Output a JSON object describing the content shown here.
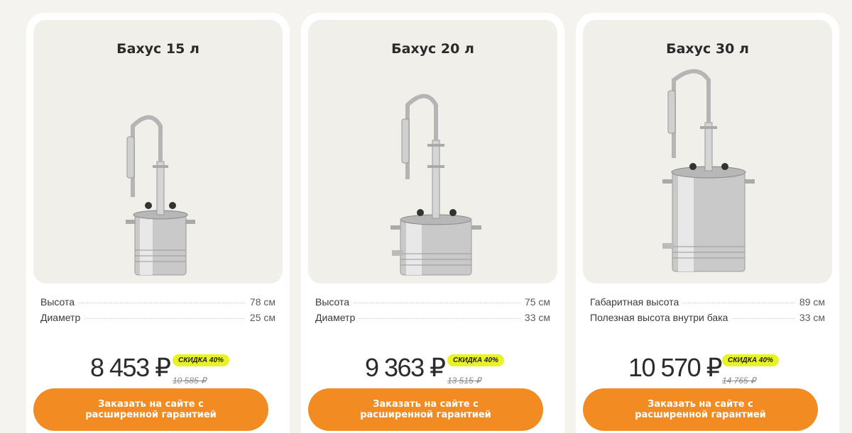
{
  "products": [
    {
      "title": "Бахус 15 л",
      "specs": [
        {
          "label": "Высота",
          "value": "78 см"
        },
        {
          "label": "Диаметр",
          "value": "25 см"
        }
      ],
      "price": "8 453 ₽",
      "discount": "СКИДКА 40%",
      "old_price": "10 585 ₽",
      "cta": "Заказать на сайте с расширенной гарантией"
    },
    {
      "title": "Бахус 20 л",
      "specs": [
        {
          "label": "Высота",
          "value": "75 см"
        },
        {
          "label": "Диаметр",
          "value": "33 см"
        }
      ],
      "price": "9 363 ₽",
      "discount": "СКИДКА 40%",
      "old_price": "13 515 ₽",
      "cta": "Заказать на сайте с расширенной гарантией"
    },
    {
      "title": "Бахус 30 л",
      "specs": [
        {
          "label": "Габаритная высота",
          "value": "89 см"
        },
        {
          "label": "Полезная высота внутри бака",
          "value": "33 см"
        }
      ],
      "price": "10 570 ₽",
      "discount": "СКИДКА 40%",
      "old_price": "14 765 ₽",
      "cta": "Заказать на сайте с расширенной гарантией"
    }
  ],
  "colors": {
    "page_bg": "#f4f3ef",
    "card_bg": "#ffffff",
    "media_bg": "#f1efea",
    "cta": "#f28c22",
    "badge": "#e8f225"
  }
}
